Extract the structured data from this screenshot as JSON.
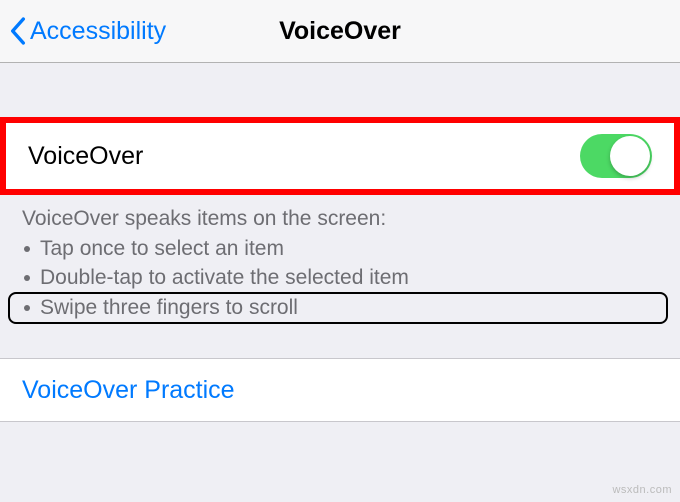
{
  "nav": {
    "back_label": "Accessibility",
    "title": "VoiceOver"
  },
  "main_toggle": {
    "label": "VoiceOver",
    "on": true
  },
  "description": {
    "heading": "VoiceOver speaks items on the screen:",
    "items": [
      "Tap once to select an item",
      "Double-tap to activate the selected item",
      "Swipe three fingers to scroll"
    ]
  },
  "practice": {
    "label": "VoiceOver Practice"
  },
  "watermark": "wsxdn.com"
}
